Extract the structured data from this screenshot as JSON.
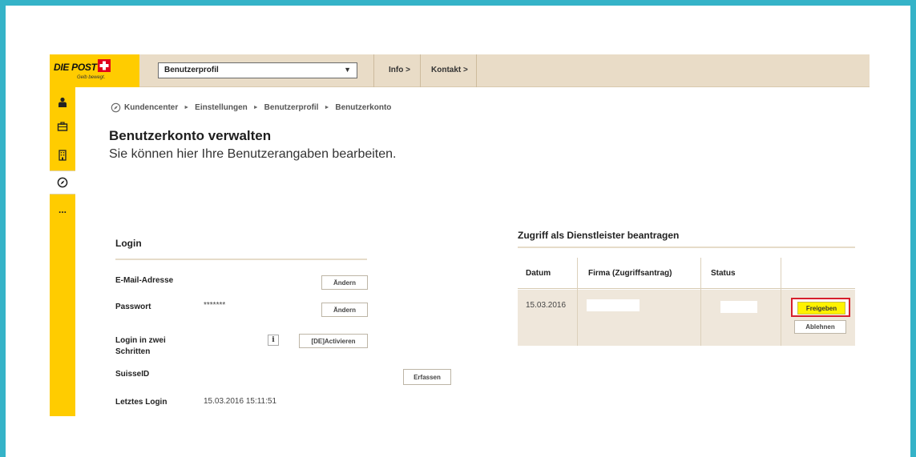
{
  "brand": {
    "logo_text": "DIE POST",
    "tagline": "Gelb bewegt."
  },
  "header": {
    "select_value": "Benutzerprofil",
    "nav": [
      {
        "label": "Info >"
      },
      {
        "label": "Kontakt >"
      }
    ]
  },
  "sidebar": {
    "items": [
      {
        "icon": "person-icon"
      },
      {
        "icon": "briefcase-icon"
      },
      {
        "icon": "building-icon"
      },
      {
        "icon": "compass-icon",
        "active": true
      },
      {
        "icon": "more-icon",
        "label": "..."
      }
    ]
  },
  "breadcrumb": {
    "icon": "compass-icon",
    "items": [
      "Kundencenter",
      "Einstellungen",
      "Benutzerprofil",
      "Benutzerkonto"
    ]
  },
  "page": {
    "title": "Benutzerkonto verwalten",
    "subtitle": "Sie können hier Ihre Benutzerangaben bearbeiten."
  },
  "login": {
    "title": "Login",
    "email_label": "E-Mail-Adresse",
    "email_button": "Ändern",
    "password_label": "Passwort",
    "password_value": "*******",
    "password_button": "Ändern",
    "twostep_label_line1": "Login in zwei",
    "twostep_label_line2": "Schritten",
    "twostep_info": "i",
    "twostep_button": "[DE]Activieren",
    "suisseid_label": "SuisseID",
    "suisseid_button": "Erfassen",
    "lastlogin_label": "Letztes Login",
    "lastlogin_value": "15.03.2016 15:11:51"
  },
  "access": {
    "title": "Zugriff als Dienstleister beantragen",
    "columns": [
      "Datum",
      "Firma (Zugriffsantrag)",
      "Status",
      ""
    ],
    "rows": [
      {
        "date": "15.03.2016",
        "approve": "Freigeben",
        "reject": "Ablehnen"
      }
    ]
  },
  "colors": {
    "accent": "#ffcc00",
    "frame": "#35b3c8",
    "highlight": "#d6202c",
    "button_highlight": "#fff200"
  }
}
